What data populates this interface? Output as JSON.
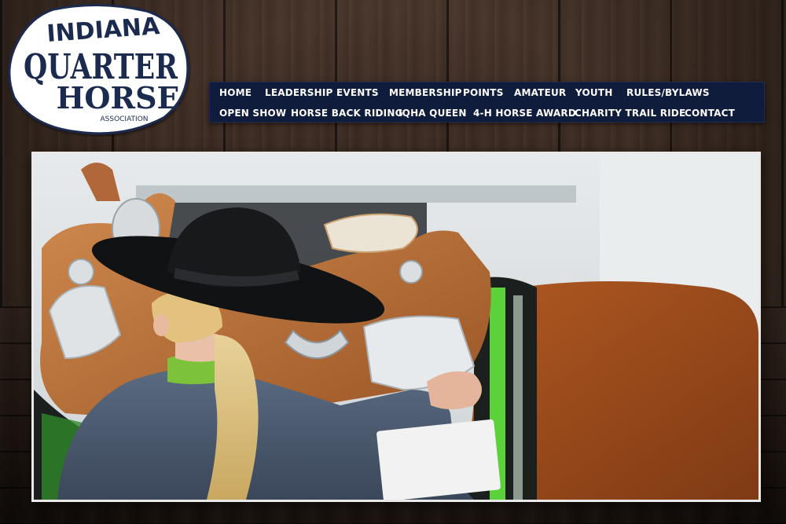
{
  "logo": {
    "line1": "INDIANA",
    "line2": "QUARTER",
    "line3": "HORSE",
    "line4": "ASSOCIATION"
  },
  "nav": {
    "row1": [
      "HOME",
      "LEADERSHIP",
      "EVENTS",
      "MEMBERSHIP",
      "POINTS",
      "AMATEUR",
      "YOUTH",
      "RULES/BYLAWS"
    ],
    "row2": [
      "OPEN SHOW",
      "HORSE BACK RIDING",
      "IQHA QUEEN",
      "4-H HORSE AWARD",
      "CHARITY TRAIL RIDE",
      "CONTACT"
    ]
  },
  "colors": {
    "nav_background": "#0f1c3b",
    "nav_text": "#ffffff",
    "wood": "#3d2c23",
    "logo_navy": "#1b2a4f"
  }
}
